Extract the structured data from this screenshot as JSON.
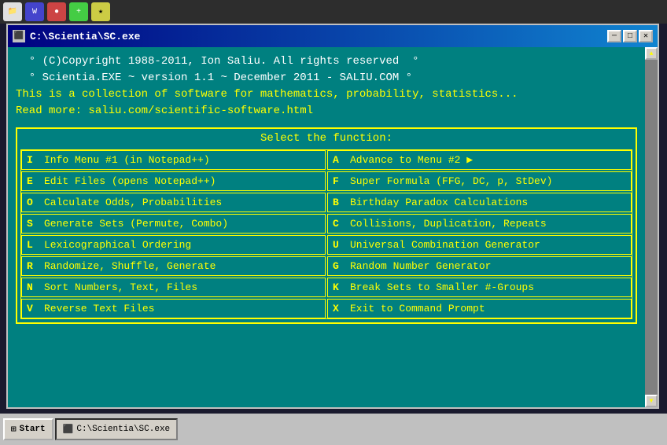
{
  "taskbar": {
    "title": "C:\\Scientia\\SC.exe",
    "start_label": "Start",
    "task_label": "C:\\Scientia\\SC.exe"
  },
  "window": {
    "title": "C:\\Scientia\\SC.exe",
    "min_btn": "─",
    "max_btn": "□",
    "close_btn": "✕"
  },
  "console": {
    "header_lines": [
      "° (C)Copyright 1988-2011, Ion Saliu. All rights reserved  °",
      "° Scientia.EXE ~ version 1.1 ~ December 2011 - SALIU.COM °",
      "This is a collection of software for mathematics, probability, statistics...",
      "Read more: saliu.com/scientific-software.html"
    ],
    "menu_title": "Select the function:",
    "menu_items": [
      {
        "key": "I",
        "label": "Info Menu #1 (in Notepad++)",
        "key2": "A",
        "label2": "Advance to Menu #2 ▶"
      },
      {
        "key": "E",
        "label": "Edit Files (opens Notepad++)",
        "key2": "F",
        "label2": "Super Formula (FFG, DC, p, StDev)"
      },
      {
        "key": "O",
        "label": "Calculate Odds, Probabilities",
        "key2": "B",
        "label2": "Birthday Paradox Calculations"
      },
      {
        "key": "S",
        "label": "Generate Sets (Permute, Combo)",
        "key2": "C",
        "label2": "Collisions, Duplication, Repeats"
      },
      {
        "key": "L",
        "label": "Lexicographical Ordering",
        "key2": "U",
        "label2": "Universal Combination Generator"
      },
      {
        "key": "R",
        "label": "Randomize, Shuffle, Generate",
        "key2": "G",
        "label2": "Random Number Generator"
      },
      {
        "key": "N",
        "label": "Sort Numbers, Text, Files",
        "key2": "K",
        "label2": "Break Sets to Smaller #-Groups"
      },
      {
        "key": "V",
        "label": "Reverse Text Files",
        "key2": "X",
        "label2": "Exit to Command Prompt"
      }
    ]
  }
}
